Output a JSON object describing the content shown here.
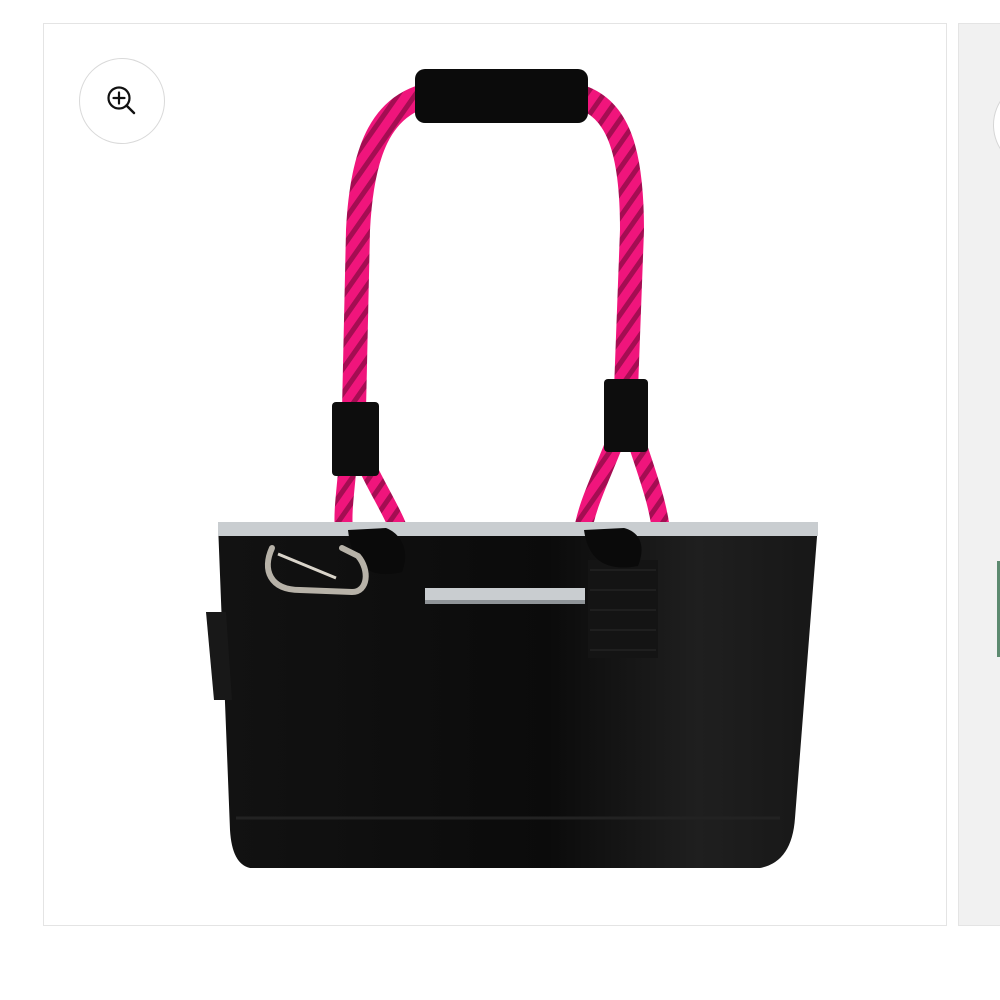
{
  "gallery": {
    "zoom_button": {
      "icon": "zoom-in-icon"
    },
    "product_image": {
      "subject": "tote-bag",
      "colors": {
        "bag": "#111111",
        "rope": "#f0157c",
        "rope_pattern": "#7a0a3a",
        "trim": "#c9cdd0",
        "carabiner": "#b7b2a8"
      }
    }
  }
}
